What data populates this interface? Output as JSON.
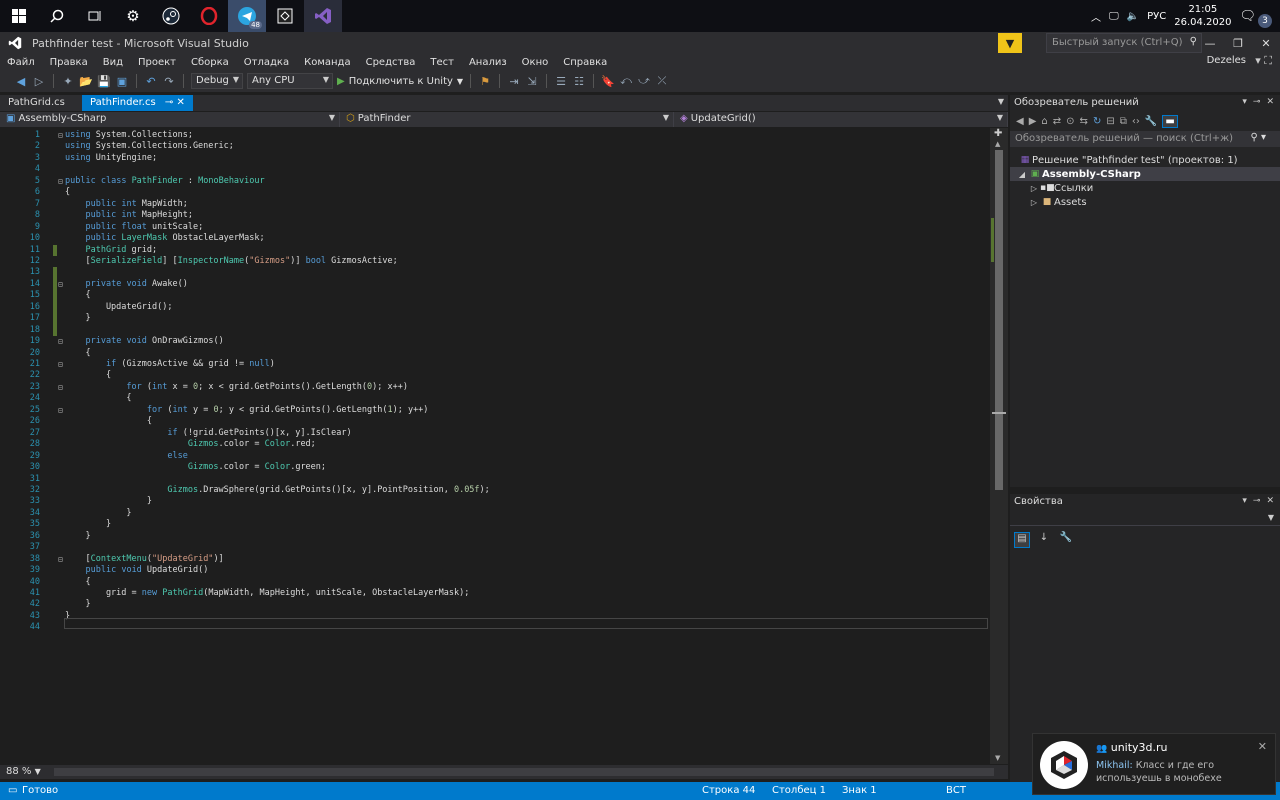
{
  "taskbar": {
    "apps": [
      "windows-start",
      "search",
      "task-view",
      "settings",
      "steam",
      "opera",
      "telegram",
      "unity",
      "visual-studio"
    ],
    "telegram_badge": "48",
    "lang": "РУС",
    "time": "21:05",
    "date": "26.04.2020",
    "notif_count": "3"
  },
  "window": {
    "title": "Pathfinder test - Microsoft Visual Studio",
    "quick_launch_placeholder": "Быстрый запуск (Ctrl+Q)"
  },
  "menu": {
    "items": [
      "Файл",
      "Правка",
      "Вид",
      "Проект",
      "Сборка",
      "Отладка",
      "Команда",
      "Средства",
      "Тест",
      "Анализ",
      "Окно",
      "Справка"
    ],
    "user": "Dezeles"
  },
  "toolbar": {
    "config": "Debug",
    "platform": "Any CPU",
    "attach_label": "Подключить к Unity"
  },
  "tabs": [
    {
      "label": "PathGrid.cs",
      "active": false
    },
    {
      "label": "PathFinder.cs",
      "active": true
    }
  ],
  "nav": {
    "project": "Assembly-CSharp",
    "class": "PathFinder",
    "member": "UpdateGrid()"
  },
  "code_lines": [
    "using System.Collections;",
    "using System.Collections.Generic;",
    "using UnityEngine;",
    "",
    "public class PathFinder : MonoBehaviour",
    "{",
    "    public int MapWidth;",
    "    public int MapHeight;",
    "    public float unitScale;",
    "    public LayerMask ObstacleLayerMask;",
    "    PathGrid grid;",
    "    [SerializeField] [InspectorName(\"Gizmos\")] bool GizmosActive;",
    "",
    "    private void Awake()",
    "    {",
    "        UpdateGrid();",
    "    }",
    "",
    "    private void OnDrawGizmos()",
    "    {",
    "        if (GizmosActive && grid != null)",
    "        {",
    "            for (int x = 0; x < grid.GetPoints().GetLength(0); x++)",
    "            {",
    "                for (int y = 0; y < grid.GetPoints().GetLength(1); y++)",
    "                {",
    "                    if (!grid.GetPoints()[x, y].IsClear)",
    "                        Gizmos.color = Color.red;",
    "                    else",
    "                        Gizmos.color = Color.green;",
    "",
    "                    Gizmos.DrawSphere(grid.GetPoints()[x, y].PointPosition, 0.05f);",
    "                }",
    "            }",
    "        }",
    "    }",
    "",
    "    [ContextMenu(\"UpdateGrid\")]",
    "    public void UpdateGrid()",
    "    {",
    "        grid = new PathGrid(MapWidth, MapHeight, unitScale, ObstacleLayerMask);",
    "    }",
    "}",
    ""
  ],
  "editor": {
    "zoom": "88 %"
  },
  "solution_explorer": {
    "title": "Обозреватель решений",
    "search_placeholder": "Обозреватель решений — поиск (Ctrl+ж)",
    "solution": "Решение \"Pathfinder test\"  (проектов: 1)",
    "project": "Assembly-CSharp",
    "refs": "Ссылки",
    "assets": "Assets"
  },
  "properties": {
    "title": "Свойства"
  },
  "status": {
    "ready": "Готово",
    "line": "Строка 44",
    "col": "Столбец 1",
    "char": "Знак 1",
    "mode": "ВСТ"
  },
  "toast": {
    "title": "unity3d.ru",
    "sender": "Mikhail:",
    "message": " Класс и  где его используешь в монобехе"
  },
  "colors": {
    "accent": "#007acc",
    "keyword": "#569cd6",
    "type": "#4ec9b0",
    "string": "#d69d85",
    "number": "#b5cea8"
  }
}
